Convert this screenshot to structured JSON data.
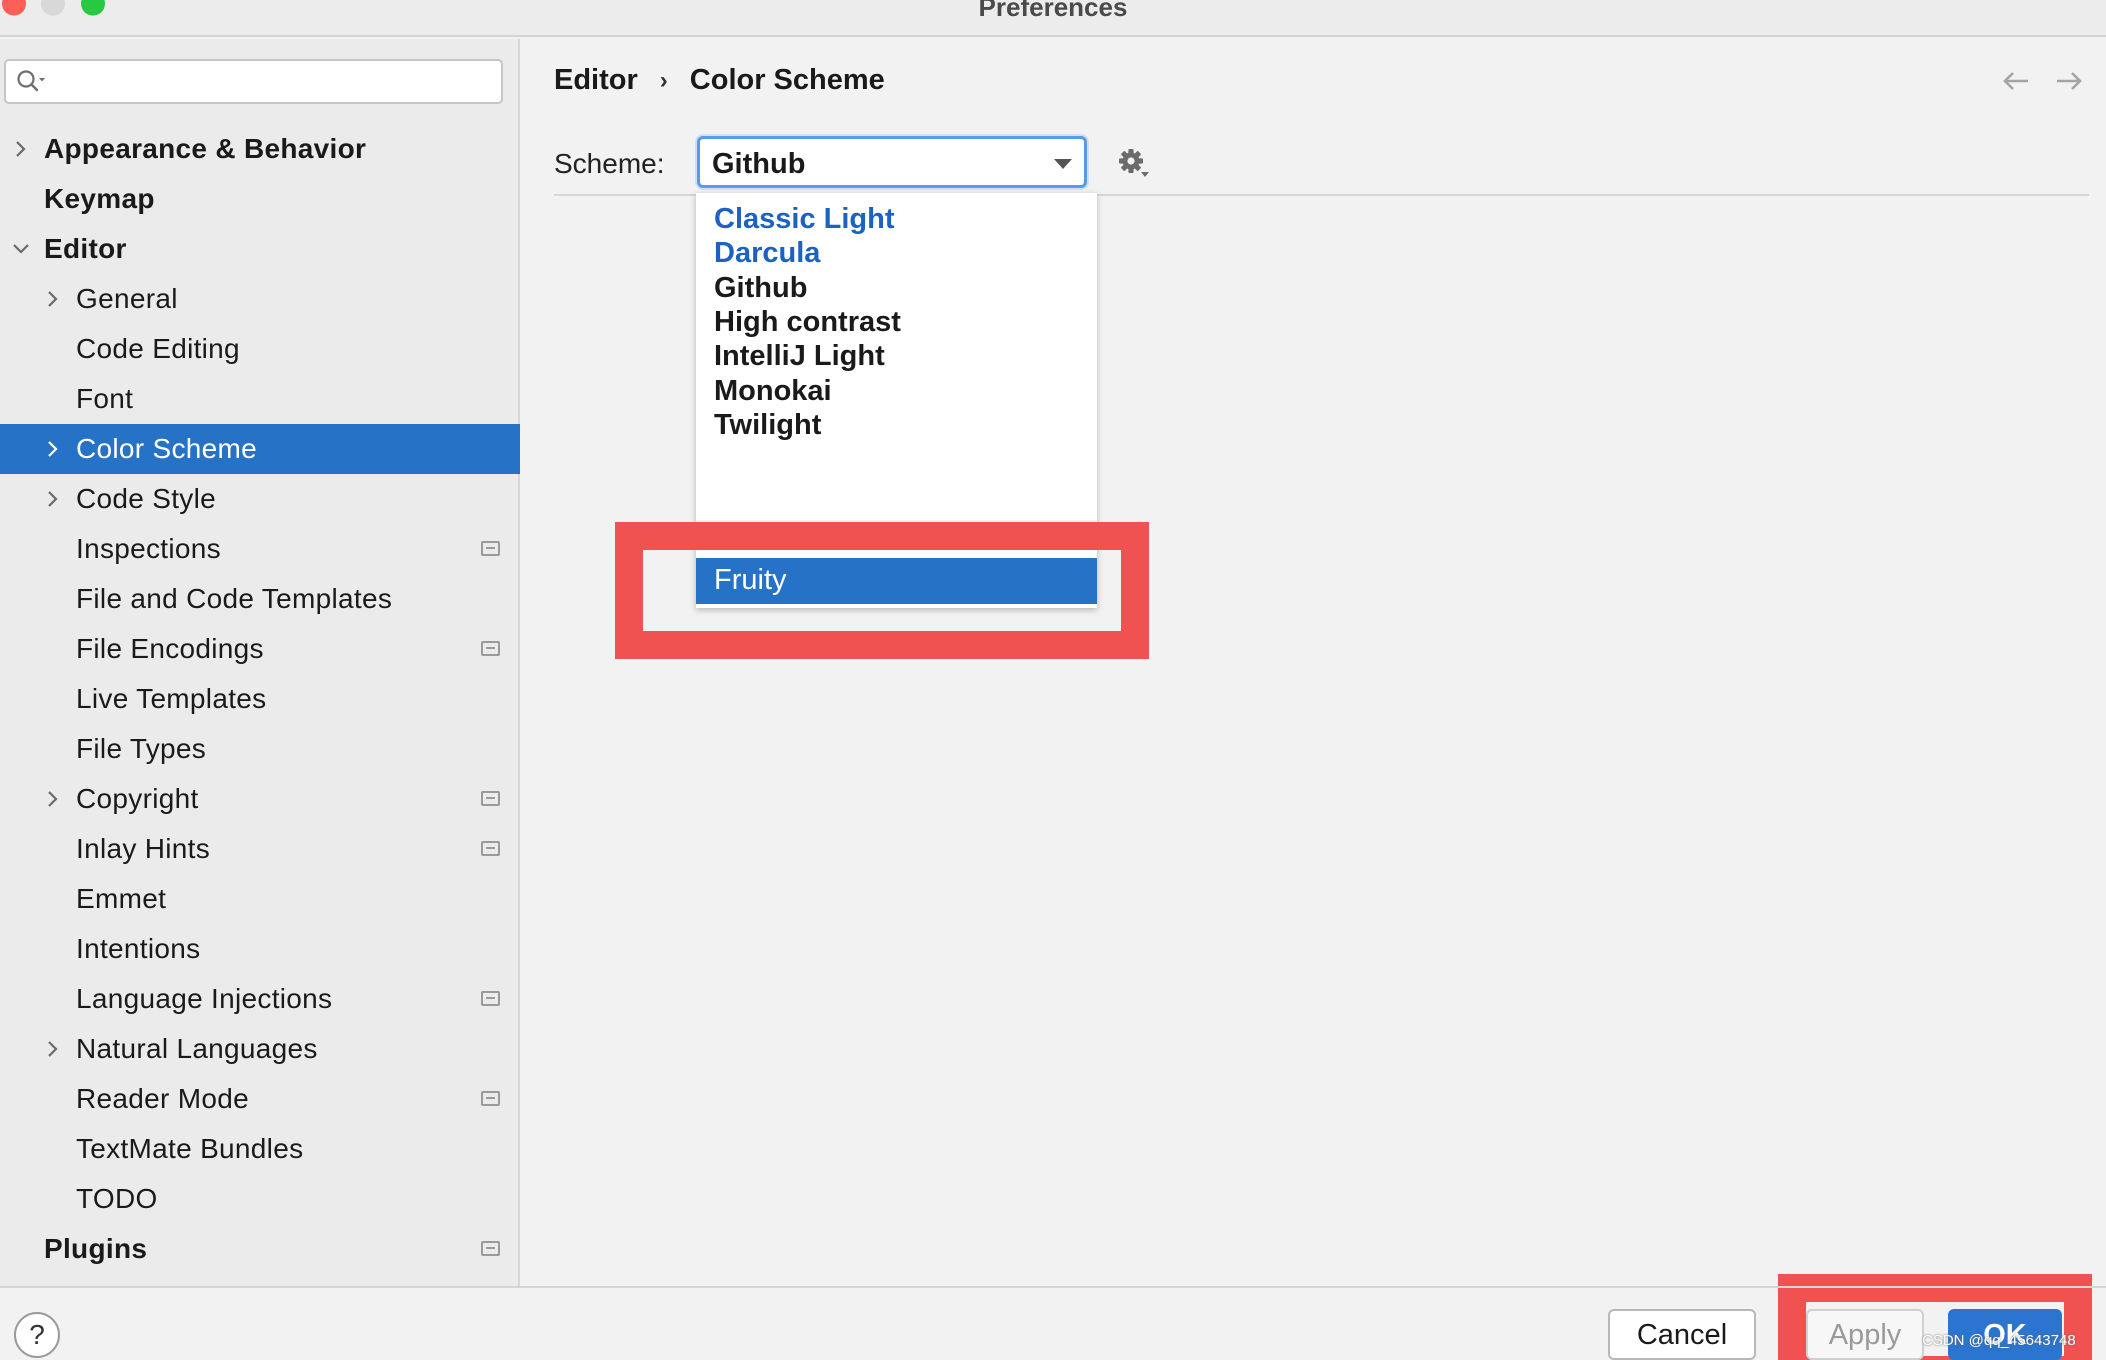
{
  "window": {
    "title": "Preferences"
  },
  "sidebar": {
    "search": {
      "placeholder": ""
    },
    "items": [
      {
        "label": "Appearance & Behavior",
        "level": 0,
        "expandable": true,
        "expanded": false,
        "marker": false,
        "selected": false
      },
      {
        "label": "Keymap",
        "level": 0,
        "expandable": false,
        "marker": false,
        "selected": false
      },
      {
        "label": "Editor",
        "level": 0,
        "expandable": true,
        "expanded": true,
        "marker": false,
        "selected": false
      },
      {
        "label": "General",
        "level": 1,
        "expandable": true,
        "expanded": false,
        "marker": false,
        "selected": false
      },
      {
        "label": "Code Editing",
        "level": 1,
        "expandable": false,
        "marker": false,
        "selected": false
      },
      {
        "label": "Font",
        "level": 1,
        "expandable": false,
        "marker": false,
        "selected": false
      },
      {
        "label": "Color Scheme",
        "level": 1,
        "expandable": true,
        "expanded": false,
        "marker": false,
        "selected": true
      },
      {
        "label": "Code Style",
        "level": 1,
        "expandable": true,
        "expanded": false,
        "marker": false,
        "selected": false
      },
      {
        "label": "Inspections",
        "level": 1,
        "expandable": false,
        "marker": true,
        "selected": false
      },
      {
        "label": "File and Code Templates",
        "level": 1,
        "expandable": false,
        "marker": false,
        "selected": false
      },
      {
        "label": "File Encodings",
        "level": 1,
        "expandable": false,
        "marker": true,
        "selected": false
      },
      {
        "label": "Live Templates",
        "level": 1,
        "expandable": false,
        "marker": false,
        "selected": false
      },
      {
        "label": "File Types",
        "level": 1,
        "expandable": false,
        "marker": false,
        "selected": false
      },
      {
        "label": "Copyright",
        "level": 1,
        "expandable": true,
        "expanded": false,
        "marker": true,
        "selected": false
      },
      {
        "label": "Inlay Hints",
        "level": 1,
        "expandable": false,
        "marker": true,
        "selected": false
      },
      {
        "label": "Emmet",
        "level": 1,
        "expandable": false,
        "marker": false,
        "selected": false
      },
      {
        "label": "Intentions",
        "level": 1,
        "expandable": false,
        "marker": false,
        "selected": false
      },
      {
        "label": "Language Injections",
        "level": 1,
        "expandable": false,
        "marker": true,
        "selected": false
      },
      {
        "label": "Natural Languages",
        "level": 1,
        "expandable": true,
        "expanded": false,
        "marker": false,
        "selected": false
      },
      {
        "label": "Reader Mode",
        "level": 1,
        "expandable": false,
        "marker": true,
        "selected": false
      },
      {
        "label": "TextMate Bundles",
        "level": 1,
        "expandable": false,
        "marker": false,
        "selected": false
      },
      {
        "label": "TODO",
        "level": 1,
        "expandable": false,
        "marker": false,
        "selected": false
      },
      {
        "label": "Plugins",
        "level": 0,
        "expandable": false,
        "marker": true,
        "selected": false
      }
    ]
  },
  "breadcrumb": {
    "parent": "Editor",
    "separator": "›",
    "current": "Color Scheme"
  },
  "scheme": {
    "label": "Scheme:",
    "value": "Github",
    "options": [
      {
        "label": "Classic Light",
        "bundled": true
      },
      {
        "label": "Darcula",
        "bundled": true
      },
      {
        "label": "Github",
        "bundled": false
      },
      {
        "label": "High contrast",
        "bundled": false
      },
      {
        "label": "IntelliJ Light",
        "bundled": false
      },
      {
        "label": "Monokai",
        "bundled": false
      },
      {
        "label": "Twilight",
        "bundled": false
      }
    ],
    "highlighted_option": "Fruity"
  },
  "footer": {
    "help_label": "?",
    "cancel_label": "Cancel",
    "apply_label": "Apply",
    "ok_label": "OK",
    "watermark": "CSDN @qq_45643748"
  },
  "colors": {
    "selection": "#2672c6",
    "bundled_scheme": "#1b62c2",
    "annotation": "#f05252",
    "ok_button": "#2b74cf"
  },
  "icons": {
    "search": "search-icon",
    "gear": "gear-icon",
    "back": "arrow-left-icon",
    "forward": "arrow-right-icon",
    "chevron_right": "chevron-right-icon",
    "chevron_down": "chevron-down-icon",
    "project_marker": "project-level-icon"
  }
}
